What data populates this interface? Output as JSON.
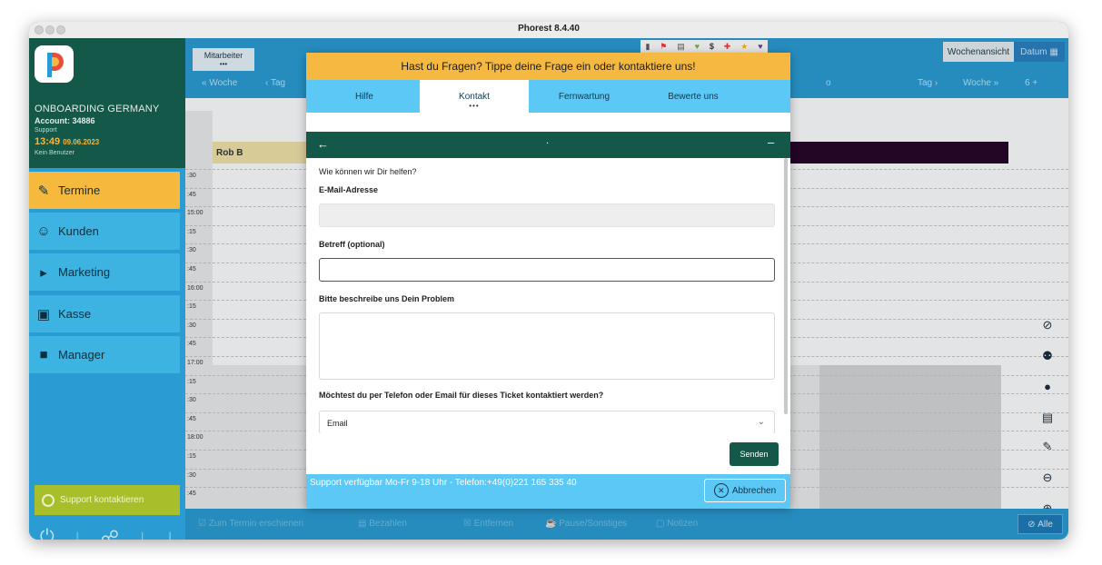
{
  "window": {
    "title": "Phorest 8.4.40"
  },
  "sidebar": {
    "org": "ONBOARDING GERMANY",
    "account": "Account: 34886",
    "role": "Support",
    "time": "13:49",
    "date": "09.06.2023",
    "no_user": "Kein Benutzer",
    "items": [
      {
        "label": "Termine",
        "icon": "calendar-edit-icon"
      },
      {
        "label": "Kunden",
        "icon": "face-icon"
      },
      {
        "label": "Marketing",
        "icon": "megaphone-icon"
      },
      {
        "label": "Kasse",
        "icon": "cart-icon"
      },
      {
        "label": "Manager",
        "icon": "briefcase-icon"
      }
    ],
    "support_label": "Support kontaktieren"
  },
  "calendar": {
    "staff_tab": "Mitarbeiter",
    "toolbar": {
      "woche_prev": "Woche",
      "tag_prev": "Tag",
      "tag_next": "Tag",
      "woche_next": "Woche",
      "count": "6",
      "wochenansicht": "Wochenansicht",
      "datum": "Datum",
      "hidden_fragment": "o"
    },
    "staff": [
      "Rob B"
    ],
    "times": [
      ":30",
      ":45",
      "15:00",
      ":15",
      ":30",
      ":45",
      "16:00",
      ":15",
      ":30",
      ":45",
      "17:00",
      ":15",
      ":30",
      ":45",
      "18:00",
      ":15",
      ":30",
      ":45"
    ],
    "actions": [
      "Zum Termin erschienen",
      "Bezahlen",
      "Entfernen",
      "Pause/Sonstiges",
      "Notizen"
    ],
    "filter_label": "Alle"
  },
  "modal": {
    "header": "Hast du Fragen? Tippe deine Frage ein oder kontaktiere uns!",
    "tabs": [
      "Hilfe",
      "Kontakt",
      "Fernwartung",
      "Bewerte uns"
    ],
    "active_tab_dots": "•••",
    "bar_title": ".",
    "intro": "Wie können wir Dir helfen?",
    "email_label": "E-Mail-Adresse",
    "email_value": "",
    "subject_label": "Betreff (optional)",
    "subject_value": "",
    "problem_label": "Bitte beschreibe uns Dein Problem",
    "problem_value": "",
    "contact_label": "Möchtest du per Telefon oder Email für dieses Ticket kontaktiert werden?",
    "contact_selected": "Email",
    "send_label": "Senden",
    "footer_text": "Support verfügbar Mo-Fr 9-18 Uhr  - Telefon:+49(0)221 165 335 40",
    "cancel_label": "Abbrechen"
  },
  "colors": {
    "brand_dark": "#135849",
    "accent_yellow": "#f5b942",
    "accent_blue": "#5bc8f5",
    "sidebar_blue": "#2a9bd3"
  }
}
